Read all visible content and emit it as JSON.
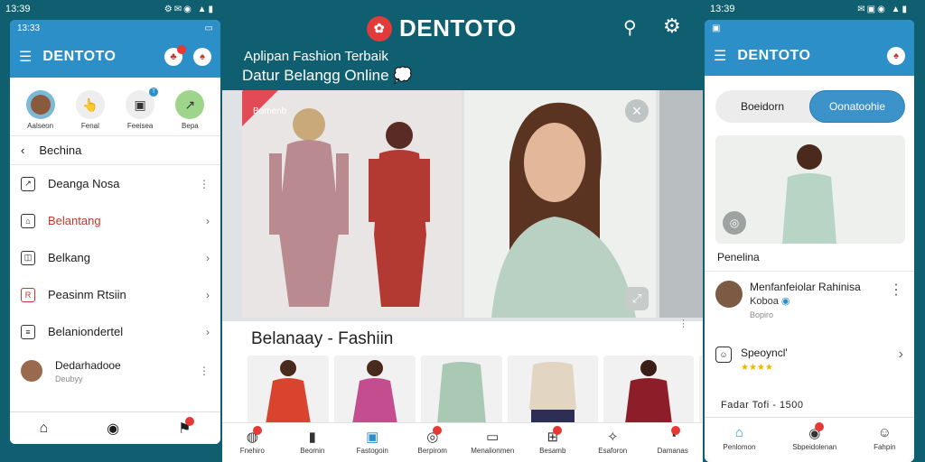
{
  "status_left": {
    "time": "13:39"
  },
  "status_center_left": {
    "time": "13:39"
  },
  "status_right": {
    "time": "13:39"
  },
  "left_phone": {
    "inner_time": "13:33",
    "brand": "DENTOTO",
    "quick_actions": [
      {
        "label": "Aalseon",
        "icon": "avatar",
        "color": "#7db8d6",
        "badge": ""
      },
      {
        "label": "Fenal",
        "icon": "👆",
        "color": "#eeeeee",
        "badge": ""
      },
      {
        "label": "Feeisea",
        "icon": "▣",
        "color": "#eeeeee",
        "badge": "T"
      },
      {
        "label": "Bepa",
        "icon": "↗",
        "color": "#9fd48b",
        "badge": ""
      }
    ],
    "back_label": "Bechina",
    "menu": [
      {
        "label": "Deanga Nosa",
        "icon": "↗",
        "trail": "⋮",
        "color": "#222"
      },
      {
        "label": "Belantang",
        "icon": "⌂",
        "trail": "›",
        "color": "#c0392b"
      },
      {
        "label": "Belkang",
        "icon": "◫",
        "trail": "›",
        "color": "#222"
      },
      {
        "label": "Peasinm Rtsiin",
        "icon": "R",
        "trail": "›",
        "color": "#222"
      },
      {
        "label": "Belaniondertel",
        "icon": "≡",
        "trail": "›",
        "color": "#222"
      }
    ],
    "contact": {
      "name": "Dedarhadooe",
      "sub": "Deubyy"
    },
    "tabs": [
      "⌂",
      "◉",
      "⚑"
    ]
  },
  "center": {
    "brand": "DENTOTO",
    "tagline1": "Aplipan Fashion Terbaik",
    "tagline2": "Datur Belangg Online",
    "ribbon_tag": "Bomenb",
    "section_title": "Belanaay - Fashiin",
    "thumb_colors": [
      "#d9442e",
      "#c44d8f",
      "#a9c9b5",
      "#e2d5c2",
      "#8e1d2a",
      "#3a3a3a"
    ],
    "tabs": [
      {
        "label": "Fnehiro",
        "icon": "◍",
        "badge": true
      },
      {
        "label": "Beomin",
        "icon": "▮",
        "badge": false
      },
      {
        "label": "Fastogoin",
        "icon": "▣",
        "badge": false
      },
      {
        "label": "Berpirom",
        "icon": "◎",
        "badge": true
      },
      {
        "label": "Menalionmen",
        "icon": "▭",
        "badge": false
      },
      {
        "label": "Besamb",
        "icon": "⊞",
        "badge": true
      },
      {
        "label": "Esaforon",
        "icon": "✧",
        "badge": false
      },
      {
        "label": "Damanas",
        "icon": "◔",
        "badge": true
      }
    ]
  },
  "right_phone": {
    "inner_time": "",
    "brand": "DENTOTO",
    "seg_off": "Boeidorn",
    "seg_on": "Oonatoohie",
    "product_label": "Penelina",
    "profile": {
      "title": "Menfanfeiolar Rahinisa",
      "sub": "Koboa",
      "meta": "Bopiro"
    },
    "setting": {
      "title": "Speoyncl'",
      "stars": "★★★★"
    },
    "price": "Fadar Tofi - 1500",
    "tabs": [
      {
        "label": "Penlomon",
        "icon": "⌂",
        "badge": false
      },
      {
        "label": "Sbpeidolenan",
        "icon": "◉",
        "badge": true
      },
      {
        "label": "Fahpin",
        "icon": "☺",
        "badge": false
      }
    ]
  }
}
